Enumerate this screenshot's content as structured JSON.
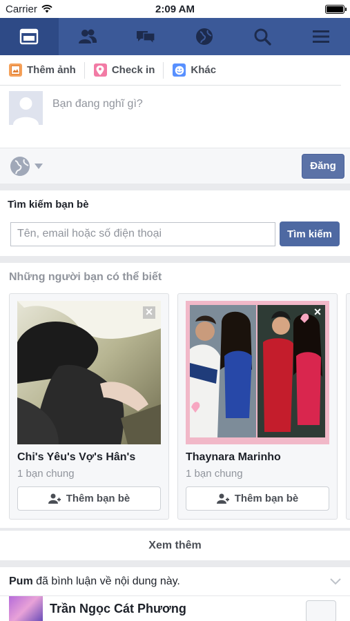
{
  "status_bar": {
    "carrier": "Carrier",
    "time": "2:09 AM",
    "battery_level": 1.0
  },
  "navbar": {
    "items": [
      {
        "icon": "news-feed-icon",
        "active": true
      },
      {
        "icon": "friends-icon",
        "active": false
      },
      {
        "icon": "messages-icon",
        "active": false
      },
      {
        "icon": "globe-icon",
        "active": false
      },
      {
        "icon": "search-icon",
        "active": false
      },
      {
        "icon": "menu-icon",
        "active": false
      }
    ]
  },
  "composer": {
    "actions": [
      {
        "label": "Thêm ảnh",
        "icon": "photo-icon"
      },
      {
        "label": "Check in",
        "icon": "location-pin-icon"
      },
      {
        "label": "Khác",
        "icon": "smiley-icon"
      }
    ],
    "placeholder": "Bạn đang nghĩ gì?",
    "post_label": "Đăng"
  },
  "find_friends": {
    "title": "Tìm kiếm bạn bè",
    "placeholder": "Tên, email hoặc số điện thoại",
    "button_label": "Tìm kiếm"
  },
  "pymk": {
    "title": "Những người bạn có thể biết",
    "cards": [
      {
        "name": "Chi's Yêu's Vợ's Hân's",
        "mutual": "1 bạn chung",
        "button": "Thêm bạn bè"
      },
      {
        "name": "Thaynara Marinho",
        "mutual": "1 bạn chung",
        "button": "Thêm bạn bè"
      }
    ]
  },
  "see_more": "Xem thêm",
  "story": {
    "actor": "Pum",
    "action": " đã bình luận về nội dung này.",
    "author": "Trần Ngọc Cát Phương"
  },
  "colors": {
    "brand": "#3b5998",
    "background": "#e9eaed",
    "button": "#4e69a2"
  }
}
